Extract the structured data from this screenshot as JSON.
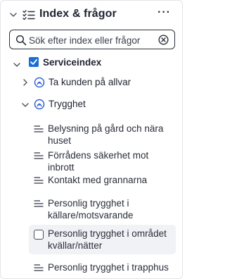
{
  "header": {
    "title": "Index & frågor",
    "more": "···"
  },
  "search": {
    "placeholder": "Sök efter index eller frågor"
  },
  "tree": {
    "root": {
      "label": "Serviceindex",
      "checked": true
    },
    "groups": [
      {
        "label": "Ta kunden på allvar",
        "expanded": false
      },
      {
        "label": "Trygghet",
        "expanded": true
      }
    ],
    "items": [
      {
        "label": "Belysning på gård och nära huset"
      },
      {
        "label": "Förrådens säkerhet mot inbrott"
      },
      {
        "label": "Kontakt med grannarna"
      },
      {
        "label": "Personlig trygghet i källare/motsvarande"
      },
      {
        "label": "Personlig trygghet i området kvällar/nätter",
        "hovered": true
      },
      {
        "label": "Personlig trygghet i trapphus"
      }
    ]
  },
  "colors": {
    "accent": "#1a6fd4",
    "icon_blue": "#2e63d6",
    "hover": "#f1f2f5"
  }
}
